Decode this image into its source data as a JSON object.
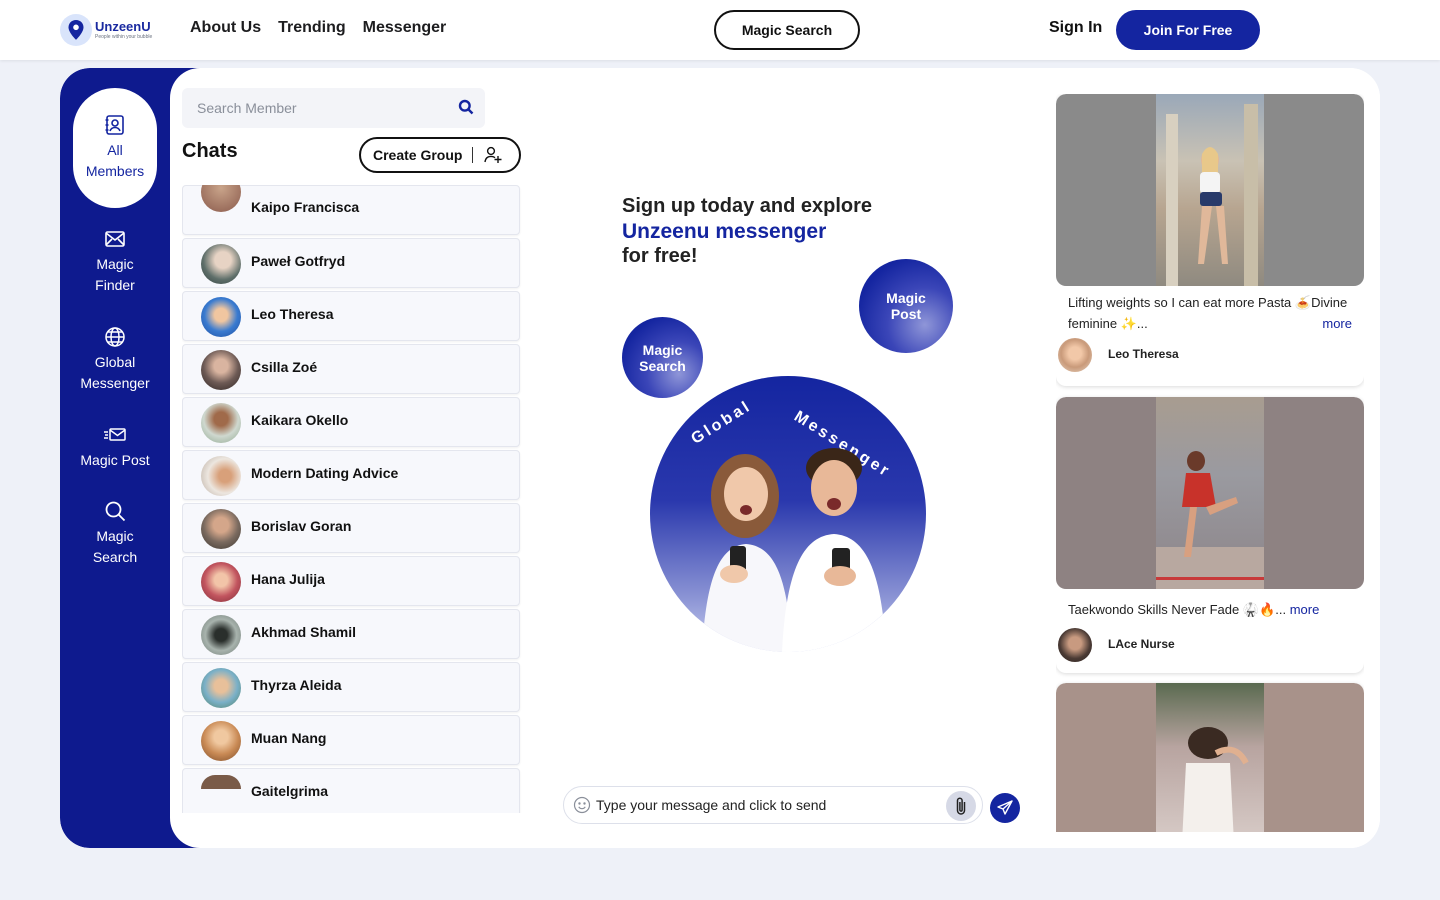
{
  "header": {
    "logo_name": "UnzeenU",
    "logo_tagline": "People within your bubble",
    "nav": [
      "About Us",
      "Trending",
      "Messenger"
    ],
    "magic_search_label": "Magic Search",
    "sign_in_label": "Sign In",
    "join_label": "Join For Free"
  },
  "sidebar": {
    "items": [
      {
        "label1": "All",
        "label2": "Members",
        "icon": "contacts-book-icon",
        "active": true
      },
      {
        "label1": "Magic",
        "label2": "Finder",
        "icon": "envelope-icon",
        "active": false
      },
      {
        "label1": "Global",
        "label2": "Messenger",
        "icon": "globe-icon",
        "active": false
      },
      {
        "label1": "Magic Post",
        "label2": "",
        "icon": "fast-mail-icon",
        "active": false
      },
      {
        "label1": "Magic",
        "label2": "Search",
        "icon": "search-icon",
        "active": false
      }
    ]
  },
  "chats": {
    "search_placeholder": "Search Member",
    "title": "Chats",
    "create_group_label": "Create Group",
    "members": [
      "Kaipo Francisca",
      "Paweł Gotfryd",
      "Leo Theresa",
      "Csilla Zoé",
      "Kaikara Okello",
      "Modern Dating Advice",
      "Borislav Goran",
      "Hana Julija",
      "Akhmad Shamil",
      "Thyrza Aleida",
      "Muan Nang",
      "Gaitelgrima"
    ]
  },
  "promo": {
    "line1": "Sign up today and explore",
    "line2": "Unzeenu messenger",
    "line3": "for free!",
    "bubble_search": "Magic Search",
    "bubble_post": "Magic Post",
    "circle_word1": "Global",
    "circle_word2": "Messenger"
  },
  "message": {
    "placeholder": "Type your message and click to send"
  },
  "feed": {
    "more_label": "more",
    "posts": [
      {
        "caption": "Lifting weights so I can eat more Pasta 🍝Divine feminine ✨...",
        "author": "Leo Theresa"
      },
      {
        "caption": "Taekwondo Skills Never Fade 🥋🔥...",
        "author": "LAce Nurse"
      },
      {
        "caption": "",
        "author": ""
      }
    ]
  },
  "colors": {
    "brand_blue": "#1425a0",
    "sidebar_blue": "#0e1a8e",
    "page_bg": "#eef1f8"
  }
}
